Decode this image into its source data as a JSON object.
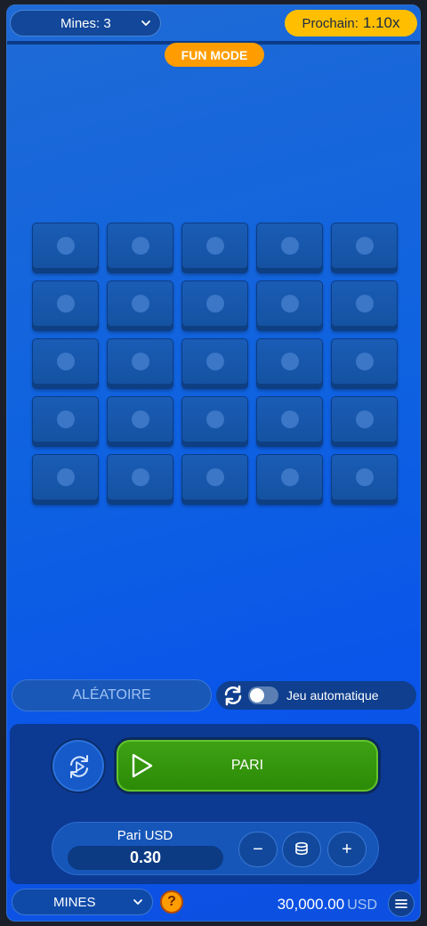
{
  "top": {
    "mines_label": "Mines: 3",
    "next_label": "Prochain:",
    "next_multiplier": "1.10x",
    "fun_mode": "FUN MODE"
  },
  "grid": {
    "rows": 5,
    "cols": 5
  },
  "controls": {
    "random_label": "ALÉATOIRE",
    "auto_label": "Jeu automatique",
    "auto_enabled": false
  },
  "bet": {
    "button_label": "PARI",
    "amount_title": "Pari USD",
    "amount_value": "0.30",
    "minus": "−",
    "plus": "+"
  },
  "bottom": {
    "game_label": "MINES",
    "help": "?",
    "balance": "30,000.00",
    "currency": "USD"
  },
  "colors": {
    "accent_orange": "#ff9d00",
    "multiplier_yellow": "#ffbf00",
    "bet_green": "#3fa214"
  },
  "icons": [
    "chevron-down-icon",
    "sync-icon",
    "cycle-icon",
    "play-icon",
    "coins-stack-icon",
    "menu-icon"
  ]
}
